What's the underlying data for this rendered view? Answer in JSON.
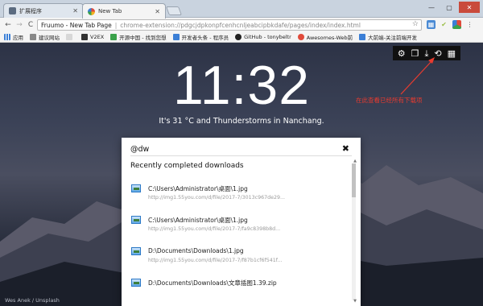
{
  "browser": {
    "tabs": [
      {
        "label": "扩展程序",
        "icon": "puzzle-icon",
        "active": false
      },
      {
        "label": "New Tab",
        "icon": "fruumo-icon",
        "active": true
      }
    ],
    "window_buttons": {
      "minimize": "—",
      "maximize": "▢",
      "close": "✕"
    },
    "nav": {
      "back": "←",
      "forward": "→",
      "reload": "C"
    },
    "omnibox": {
      "title": "Fruumo - New Tab Page",
      "separator": "|",
      "url": "chrome-extension://pdgcjdpkonpfcenhcnljeabcipbkdafe/pages/index/index.html"
    },
    "extensions": [
      {
        "icon": "ext-grid-icon",
        "color": "#4a8ad4"
      },
      {
        "icon": "ext-check-icon",
        "color": "#9cbf4a"
      },
      {
        "icon": "ext-colorful-icon",
        "color": "#d94a3a"
      }
    ],
    "bookmarks": [
      {
        "label": "应用",
        "icon": "apps-icon"
      },
      {
        "label": "建议网站",
        "icon": "suggest-icon"
      },
      {
        "label": "",
        "icon": "bookmark-icon"
      },
      {
        "label": "V2EX",
        "icon": "v2ex-icon"
      },
      {
        "label": "开源中国 - 找到您想",
        "icon": "oschina-icon"
      },
      {
        "label": "开发者头条 - 程序员",
        "icon": "toutiao-icon"
      },
      {
        "label": "GitHub - tonybeltr",
        "icon": "github-icon"
      },
      {
        "label": "Awesomes-Web前",
        "icon": "awesomes-icon"
      },
      {
        "label": "大前端-关注前端开发",
        "icon": "dqd-icon"
      }
    ]
  },
  "newtab": {
    "tools": [
      {
        "icon": "gear-icon",
        "glyph": "⚙"
      },
      {
        "icon": "open-tab-icon",
        "glyph": "❐"
      },
      {
        "icon": "download-icon",
        "glyph": "⤓"
      },
      {
        "icon": "history-icon",
        "glyph": "⟲"
      },
      {
        "icon": "apps-grid-icon",
        "glyph": "▦"
      }
    ],
    "clock": "11:32",
    "weather": "It's 31 °C and Thunderstorms in Nanchang.",
    "annotation": "在此查看已经所有下载项",
    "credit": "Wes Anek / Unsplash"
  },
  "panel": {
    "search_value": "@dw",
    "close_glyph": "✖",
    "section_title": "Recently completed downloads",
    "downloads": [
      {
        "path": "C:\\Users\\Administrator\\桌面\\1.jpg",
        "url": "http://img1.55you.com/d/file/2017-7/3013c967de29..."
      },
      {
        "path": "C:\\Users\\Administrator\\桌面\\1.jpg",
        "url": "http://img1.55you.com/d/file/2017-7/fa9c8398b8d..."
      },
      {
        "path": "D:\\Documents\\Downloads\\1.jpg",
        "url": "http://img1.55you.com/d/file/2017-7/f87b1cf6f541f..."
      },
      {
        "path": "D:\\Documents\\Downloads\\文章插图1.39.zip",
        "url": ""
      }
    ]
  },
  "colors": {
    "accent_red": "#e83b2f",
    "panel_bg": "#ffffff",
    "toolbar_bg": "#f4f4f4"
  }
}
